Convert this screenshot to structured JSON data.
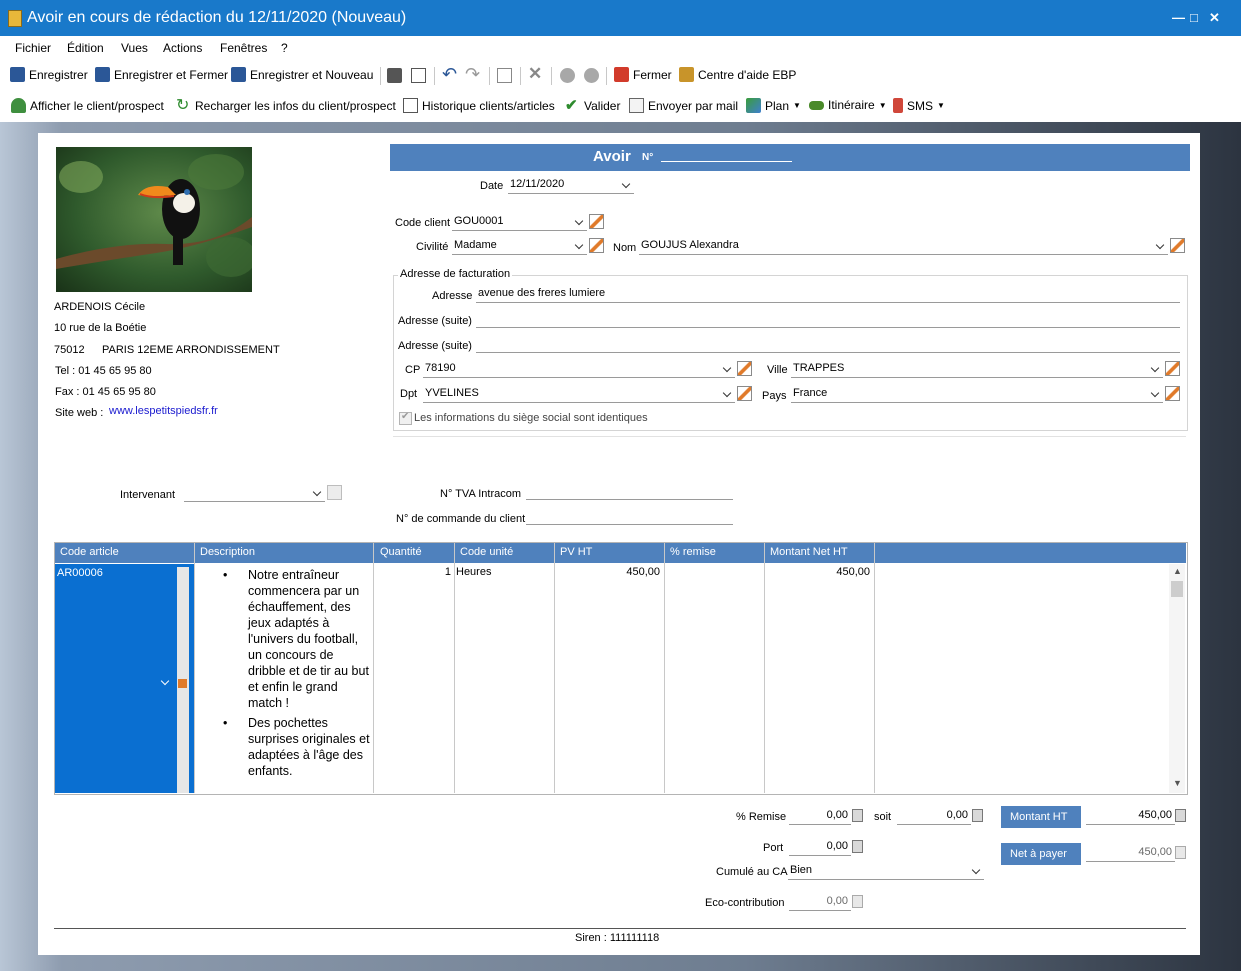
{
  "window": {
    "title": "Avoir en cours de rédaction du 12/11/2020 (Nouveau)"
  },
  "menu": [
    "Fichier",
    "Édition",
    "Vues",
    "Actions",
    "Fenêtres",
    "?"
  ],
  "toolbar1": {
    "save": "Enregistrer",
    "save_close": "Enregistrer et Fermer",
    "save_new": "Enregistrer et Nouveau",
    "close": "Fermer",
    "help": "Centre d'aide EBP"
  },
  "toolbar2": {
    "show_client": "Afficher le client/prospect",
    "reload_client": "Recharger les infos du client/prospect",
    "history": "Historique clients/articles",
    "validate": "Valider",
    "send_mail": "Envoyer par mail",
    "plan": "Plan",
    "itinerary": "Itinéraire",
    "sms": "SMS"
  },
  "company": {
    "name": "ARDENOIS Cécile",
    "street": "10 rue de la Boétie",
    "zip": "75012",
    "city": "PARIS 12EME ARRONDISSEMENT",
    "tel": "Tel :  01 45 65 95 80",
    "fax": "Fax :  01 45 65 95 80",
    "site_label": "Site web :",
    "site_url": "www.lespetitspiedsfr.fr"
  },
  "document": {
    "heading": "Avoir",
    "number_label": "N°",
    "date_label": "Date",
    "date": "12/11/2020",
    "client_code_label": "Code client",
    "client_code": "GOU0001",
    "civility_label": "Civilité",
    "civility": "Madame",
    "name_label": "Nom",
    "name": "GOUJUS Alexandra",
    "billing_legend": "Adresse de facturation",
    "address_label": "Adresse",
    "address": "avenue des freres lumiere",
    "address2_label": "Adresse (suite)",
    "address2": "",
    "address3_label": "Adresse (suite)",
    "address3": "",
    "cp_label": "CP",
    "cp": "78190",
    "city_label": "Ville",
    "city": "TRAPPES",
    "dept_label": "Dpt",
    "dept": "YVELINES",
    "country_label": "Pays",
    "country": "France",
    "same_hq": "Les informations du siège social sont identiques"
  },
  "extra": {
    "intervenant_label": "Intervenant",
    "intervenant": "",
    "vat_label": "N° TVA Intracom",
    "vat": "",
    "order_label": "N° de commande du client",
    "order": ""
  },
  "grid": {
    "columns": [
      "Code article",
      "Description",
      "Quantité",
      "Code unité",
      "PV HT",
      "% remise",
      "Montant Net HT"
    ],
    "row": {
      "code": "AR00006",
      "bullets": [
        "Notre entraîneur commencera par un échauffement, des jeux adaptés à l'univers du football, un concours de dribble et de tir au but et enfin le grand match !",
        "Des pochettes surprises originales et adaptées à l'âge des enfants."
      ],
      "qty": "1",
      "unit": "Heures",
      "pv": "450,00",
      "remise": "",
      "net": "450,00"
    }
  },
  "totals": {
    "remise_label": "% Remise",
    "remise": "0,00",
    "soit_label": "soit",
    "soit": "0,00",
    "port_label": "Port",
    "port": "0,00",
    "cumul_label": "Cumulé au CA",
    "cumul": "Bien",
    "eco_label": "Eco-contribution",
    "eco": "0,00",
    "montant_ht_label": "Montant HT",
    "montant_ht": "450,00",
    "net_label": "Net à payer",
    "net": "450,00"
  },
  "footer": {
    "siren": "Siren : 111111118"
  }
}
